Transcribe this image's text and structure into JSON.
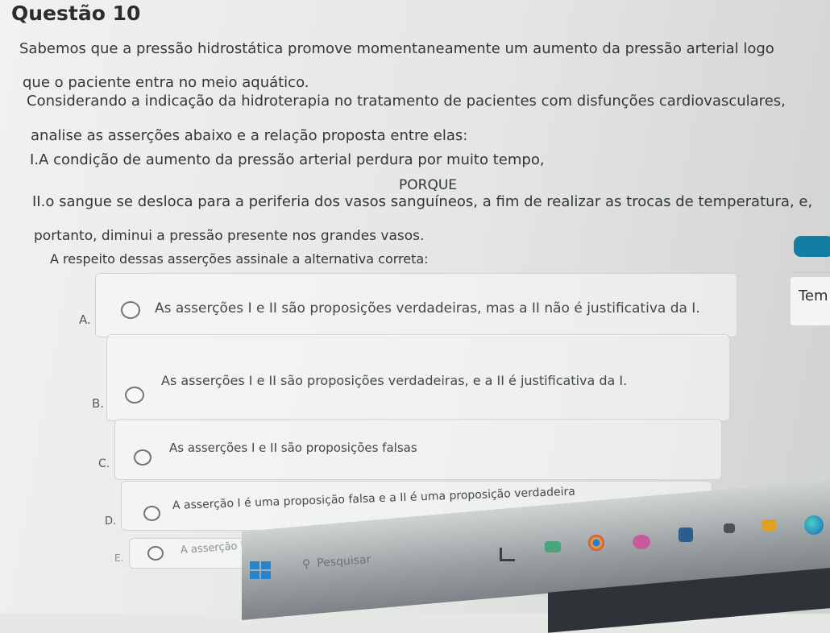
{
  "question": {
    "title": "Questão 10",
    "paragraphs": [
      "Sabemos que a pressão hidrostática promove momentaneamente um aumento da pressão arterial logo",
      "que o paciente entra no meio aquático.",
      "Considerando a indicação da hidroterapia no tratamento de pacientes com disfunções cardiovasculares,",
      "analise as asserções abaixo e a relação proposta entre elas:",
      "I.A condição de aumento da pressão arterial perdura por muito tempo,",
      "PORQUE",
      "II.o sangue se desloca para a periferia dos vasos sanguíneos, a fim de realizar as trocas de temperatura, e,",
      "portanto, diminui a pressão presente nos grandes vasos.",
      "A respeito dessas asserções assinale a alternativa correta:"
    ]
  },
  "options": [
    {
      "letter": "A.",
      "text": "As asserções I e II são proposições verdadeiras, mas a II não é justificativa da I."
    },
    {
      "letter": "B.",
      "text": "As asserções I e II são proposições verdadeiras, e a II é justificativa da I."
    },
    {
      "letter": "C.",
      "text": "As asserções I e II são proposições falsas"
    },
    {
      "letter": "D.",
      "text": "A asserção I é uma proposição falsa e a II é uma proposição verdadeira"
    },
    {
      "letter": "E.",
      "text": "A asserção I é uma proposição verdadeira e a II é uma proposição falsa"
    }
  ],
  "sidebar": {
    "timer_label": "Tem"
  },
  "taskbar": {
    "search_placeholder": "Pesquisar"
  },
  "colors": {
    "accent": "#127ea3",
    "windows_blue": "#2a84c9"
  }
}
